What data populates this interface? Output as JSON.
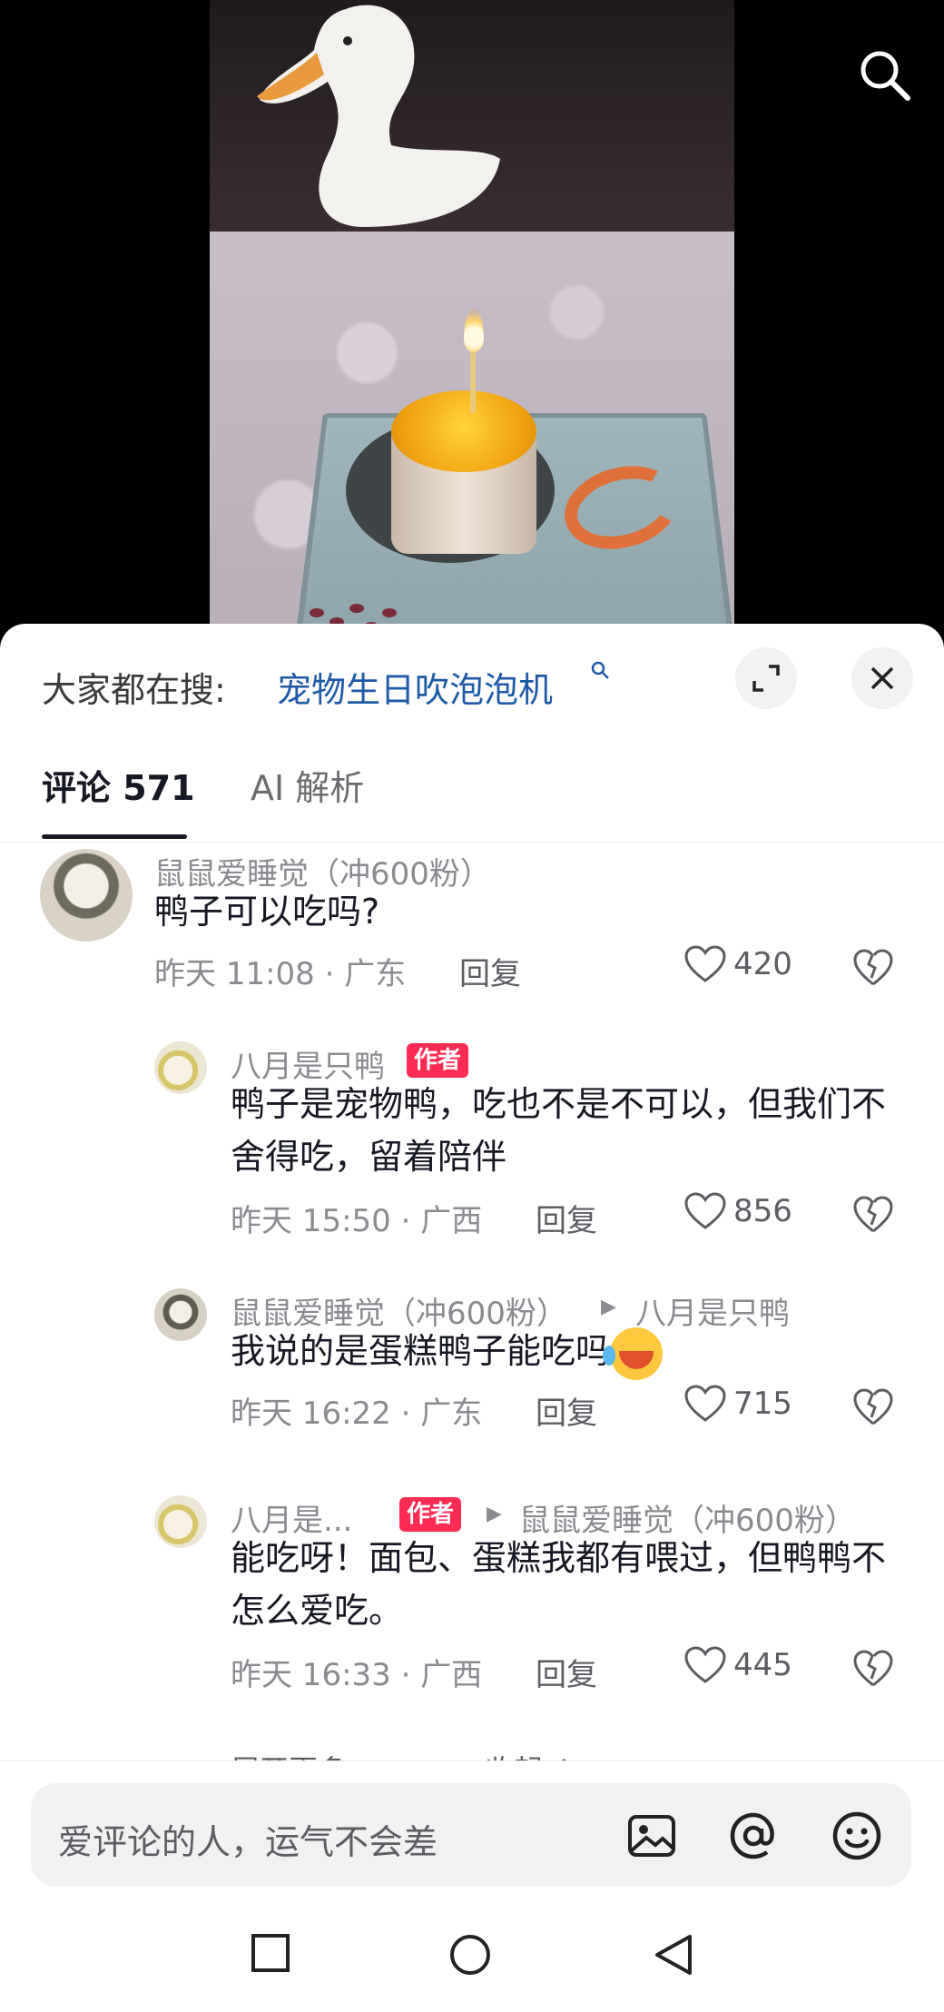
{
  "hot_search": {
    "label": "大家都在搜:",
    "query": "宠物生日吹泡泡机"
  },
  "tabs": [
    {
      "label": "评论 571",
      "active": true
    },
    {
      "label": "AI 解析",
      "active": false
    }
  ],
  "comments": [
    {
      "user": "鼠鼠爱睡觉（冲600粉）",
      "text": "鸭子可以吃吗?",
      "time": "昨天 11:08 · 广东",
      "reply_label": "回复",
      "likes": "420"
    },
    {
      "user": "八月是只鸭",
      "badge": "作者",
      "text": "鸭子是宠物鸭，吃也不是不可以，但我们不舍得吃，留着陪伴",
      "time": "昨天 15:50 · 广西",
      "reply_label": "回复",
      "likes": "856"
    },
    {
      "user": "鼠鼠爱睡觉（冲600粉）",
      "reply_to": "八月是只鸭",
      "text": "我说的是蛋糕鸭子能吃吗",
      "time": "昨天 16:22 · 广东",
      "reply_label": "回复",
      "likes": "715"
    },
    {
      "user": "八月是...",
      "badge": "作者",
      "reply_to": "鼠鼠爱睡觉（冲600粉）",
      "text": "能吃呀！面包、蛋糕我都有喂过，但鸭鸭不怎么爱吃。",
      "time": "昨天 16:33 · 广西",
      "reply_label": "回复",
      "likes": "445"
    }
  ],
  "thread_controls": {
    "expand_more": "展开更多 ⌄",
    "collapse": "收起 ⌃"
  },
  "input": {
    "placeholder": "爱评论的人，运气不会差"
  },
  "icons": {
    "search": "search-icon",
    "expand": "expand-icon",
    "close": "close-icon",
    "like": "heart-icon",
    "dislike": "broken-heart-icon",
    "image": "image-icon",
    "mention": "at-icon",
    "emoji": "emoji-icon"
  },
  "colors": {
    "accent_link": "#1e5aa8",
    "author_badge": "#fe2c55"
  }
}
